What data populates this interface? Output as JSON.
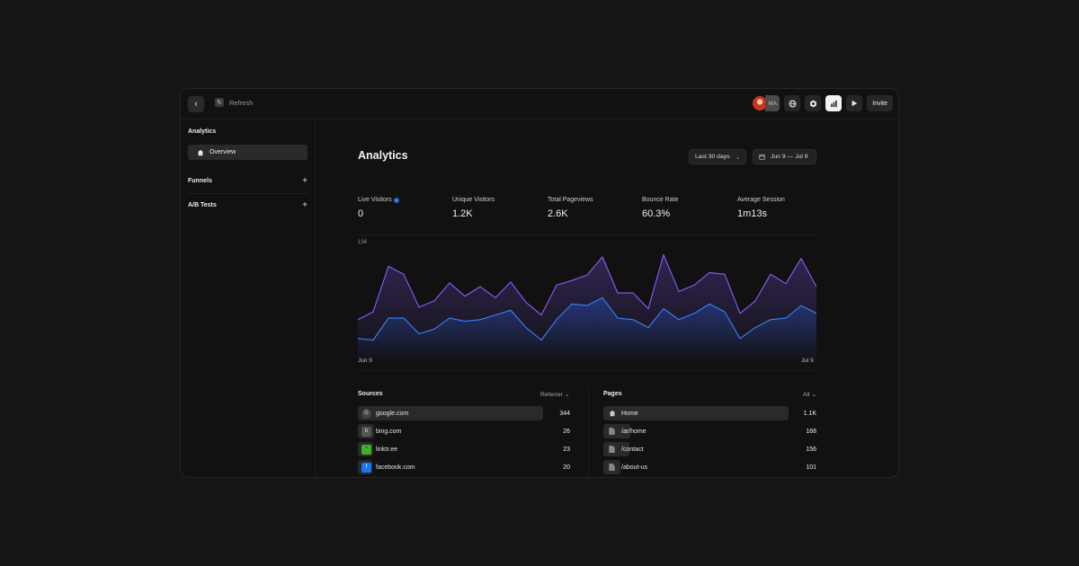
{
  "topbar": {
    "refresh_label": "Refresh",
    "avatar_initials": "MA",
    "invite_label": "Invite"
  },
  "sidebar": {
    "title": "Analytics",
    "items": [
      {
        "label": "Overview",
        "icon": "home-icon"
      }
    ],
    "sections": [
      {
        "label": "Funnels"
      },
      {
        "label": "A/B Tests"
      }
    ]
  },
  "main": {
    "title": "Analytics",
    "range_label": "Last 30 days",
    "date_label": "Jun 9 — Jul 9",
    "stats": [
      {
        "label": "Live Visitors",
        "value": "0"
      },
      {
        "label": "Unique Visitors",
        "value": "1.2K"
      },
      {
        "label": "Total Pageviews",
        "value": "2.6K"
      },
      {
        "label": "Bounce Rate",
        "value": "60.3%"
      },
      {
        "label": "Average Session",
        "value": "1m13s"
      }
    ]
  },
  "chart_data": {
    "type": "area",
    "ymax_label": "134",
    "ylim": [
      0,
      134
    ],
    "x_start_label": "Jun 9",
    "x_end_label": "Jul 9",
    "series": [
      {
        "color": "#8b5cf6",
        "values": [
          38,
          48,
          106,
          96,
          54,
          62,
          85,
          68,
          80,
          66,
          86,
          60,
          44,
          82,
          88,
          95,
          118,
          72,
          72,
          52,
          121,
          74,
          82,
          98,
          96,
          46,
          62,
          96,
          84,
          116,
          80
        ]
      },
      {
        "color": "#3b82f6",
        "values": [
          14,
          12,
          40,
          40,
          20,
          26,
          40,
          36,
          38,
          44,
          50,
          28,
          12,
          38,
          58,
          56,
          66,
          40,
          38,
          28,
          52,
          38,
          46,
          58,
          48,
          14,
          28,
          38,
          40,
          56,
          46
        ]
      }
    ]
  },
  "sources": {
    "title": "Sources",
    "filter": "Referrer",
    "rows": [
      {
        "label": "google.com",
        "value": "344",
        "icon": "google-icon"
      },
      {
        "label": "bing.com",
        "value": "26",
        "icon": "bing-icon"
      },
      {
        "label": "linktr.ee",
        "value": "23",
        "icon": "linktree-icon"
      },
      {
        "label": "facebook.com",
        "value": "20",
        "icon": "facebook-icon"
      }
    ]
  },
  "pages": {
    "title": "Pages",
    "filter": "All",
    "rows": [
      {
        "label": "Home",
        "value": "1.1K",
        "icon": "home-icon"
      },
      {
        "label": "/ar/home",
        "value": "168",
        "icon": "page-icon"
      },
      {
        "label": "/contact",
        "value": "156",
        "icon": "page-icon"
      },
      {
        "label": "/about-us",
        "value": "101",
        "icon": "page-icon"
      }
    ]
  }
}
